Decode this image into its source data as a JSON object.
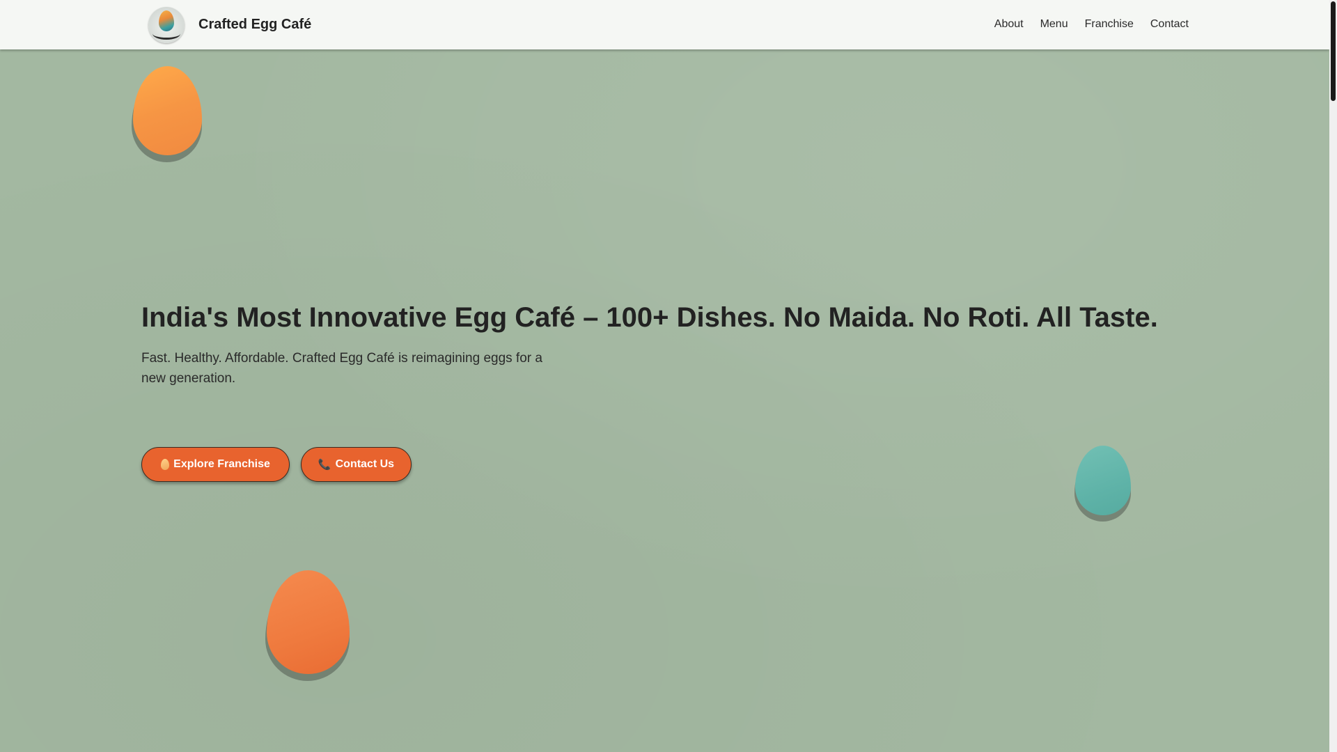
{
  "header": {
    "brand_name": "Crafted Egg Café",
    "logo_text": "Crafted Egg Café",
    "nav": [
      "About",
      "Menu",
      "Franchise",
      "Contact"
    ]
  },
  "hero": {
    "title": "India's Most Innovative Egg Café – 100+ Dishes. No Maida. No Roti. All Taste.",
    "subtitle": "Fast. Healthy. Affordable. Crafted Egg Café is reimagining eggs for a new generation.",
    "primary_button": "Explore Franchise",
    "primary_button_icon": "egg-icon",
    "secondary_button": "Contact Us",
    "secondary_button_icon": "phone-icon"
  },
  "colors": {
    "background": "#a3b8a1",
    "header_bg": "#f5f7f4",
    "button": "#e8632e",
    "egg_orange_light": "#f69544",
    "egg_orange": "#ef7a3e",
    "egg_teal": "#5fb3a8",
    "text": "#222222"
  }
}
